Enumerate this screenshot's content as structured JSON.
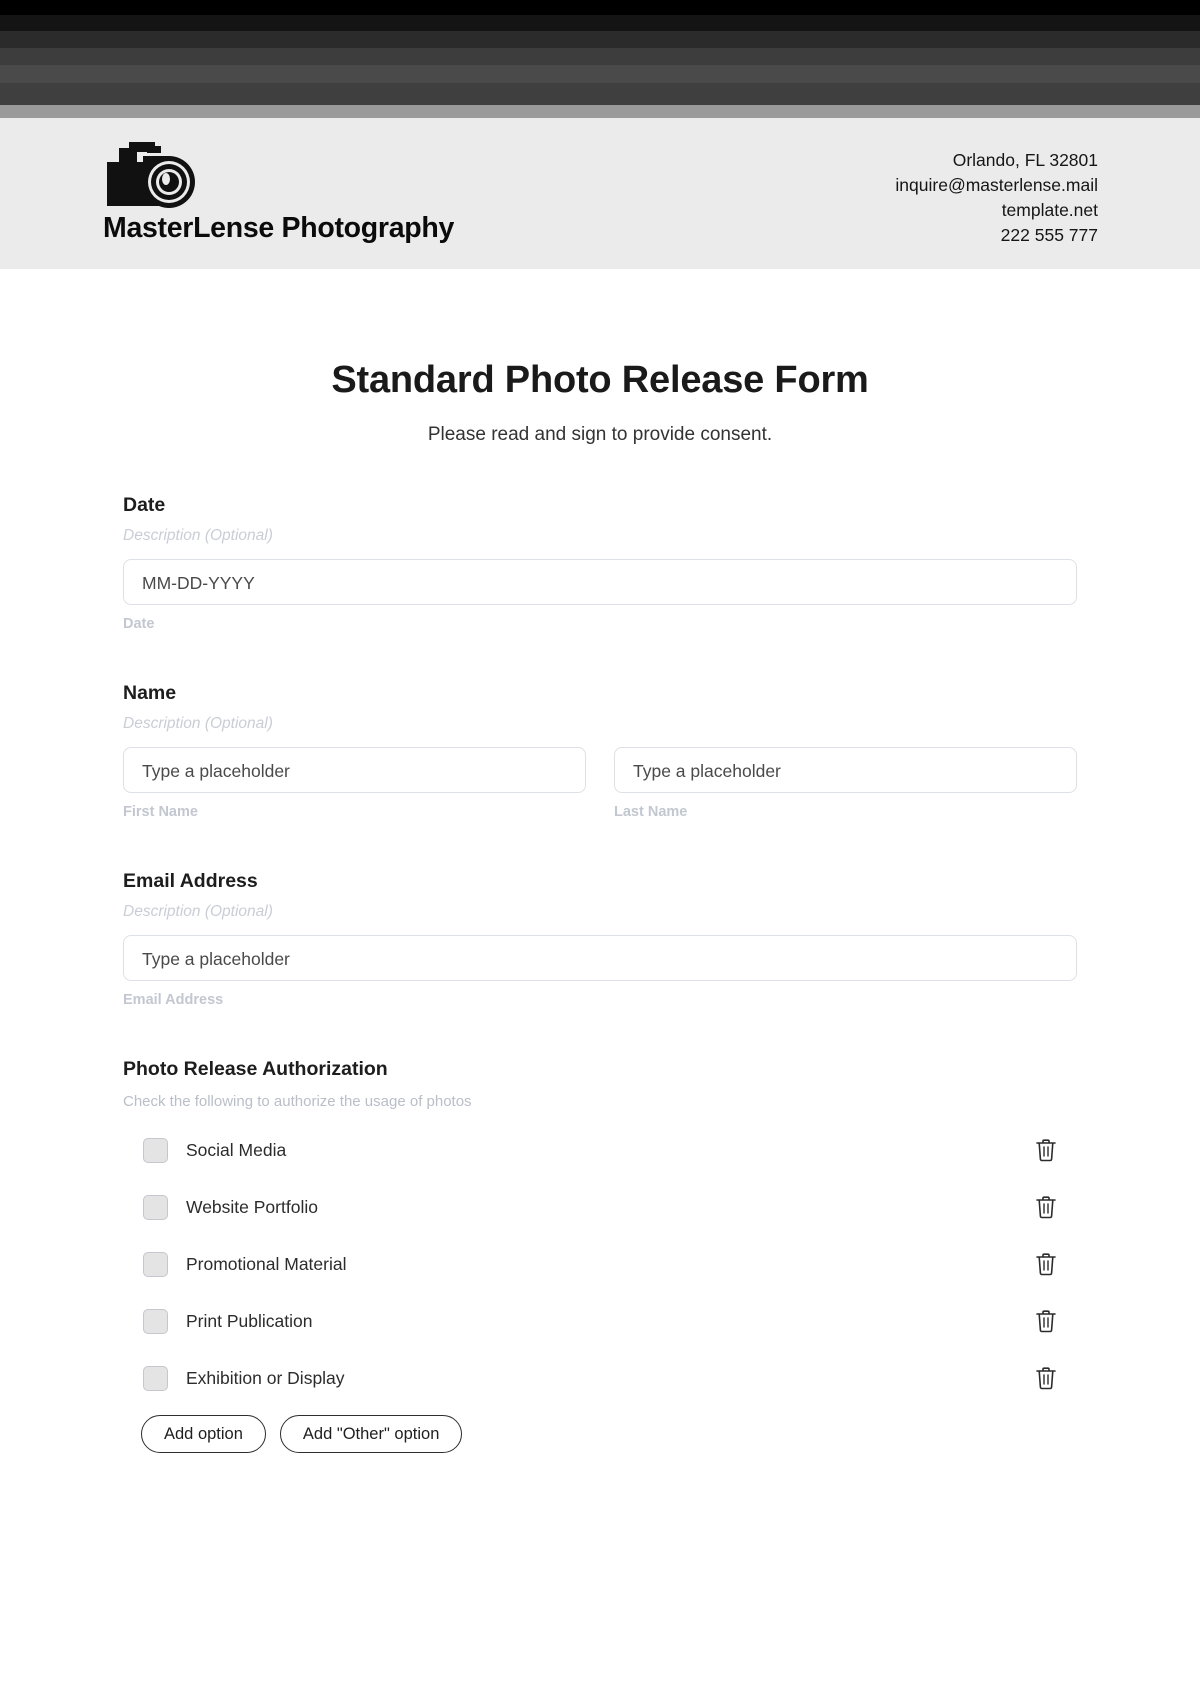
{
  "letterhead": {
    "brand_name": "MasterLense Photography",
    "logo_icon": "camera-icon",
    "contact_lines": [
      "Orlando, FL 32801",
      "inquire@masterlense.mail",
      "template.net",
      "222 555 777"
    ]
  },
  "form": {
    "title": "Standard Photo Release Form",
    "subtitle": "Please read and sign to provide consent.",
    "fields": [
      {
        "label": "Date",
        "description": "Description (Optional)",
        "inputs": [
          {
            "placeholder": "MM-DD-YYYY",
            "caption": "Date"
          }
        ]
      },
      {
        "label": "Name",
        "description": "Description (Optional)",
        "inputs": [
          {
            "placeholder": "Type a placeholder",
            "caption": "First Name"
          },
          {
            "placeholder": "Type a placeholder",
            "caption": "Last Name"
          }
        ]
      },
      {
        "label": "Email Address",
        "description": "Description (Optional)",
        "inputs": [
          {
            "placeholder": "Type a placeholder",
            "caption": "Email Address"
          }
        ]
      }
    ],
    "authorization": {
      "label": "Photo Release Authorization",
      "description": "Check the following to authorize the usage of photos",
      "options": [
        {
          "label": "Social Media",
          "checked": false,
          "delete_icon": "trash-icon"
        },
        {
          "label": "Website Portfolio",
          "checked": false,
          "delete_icon": "trash-icon"
        },
        {
          "label": "Promotional Material",
          "checked": false,
          "delete_icon": "trash-icon"
        },
        {
          "label": "Print Publication",
          "checked": false,
          "delete_icon": "trash-icon"
        },
        {
          "label": "Exhibition or Display",
          "checked": false,
          "delete_icon": "trash-icon"
        }
      ],
      "add_option_label": "Add option",
      "add_other_option_label": "Add \"Other\" option"
    }
  },
  "colors": {
    "letterhead_bg": "#ebebeb",
    "page_bg": "#ffffff",
    "text_primary": "#1d1d1d",
    "muted": "#c2c7d0",
    "input_border": "#dde0e6",
    "checkbox_fill": "#e4e4e4"
  }
}
